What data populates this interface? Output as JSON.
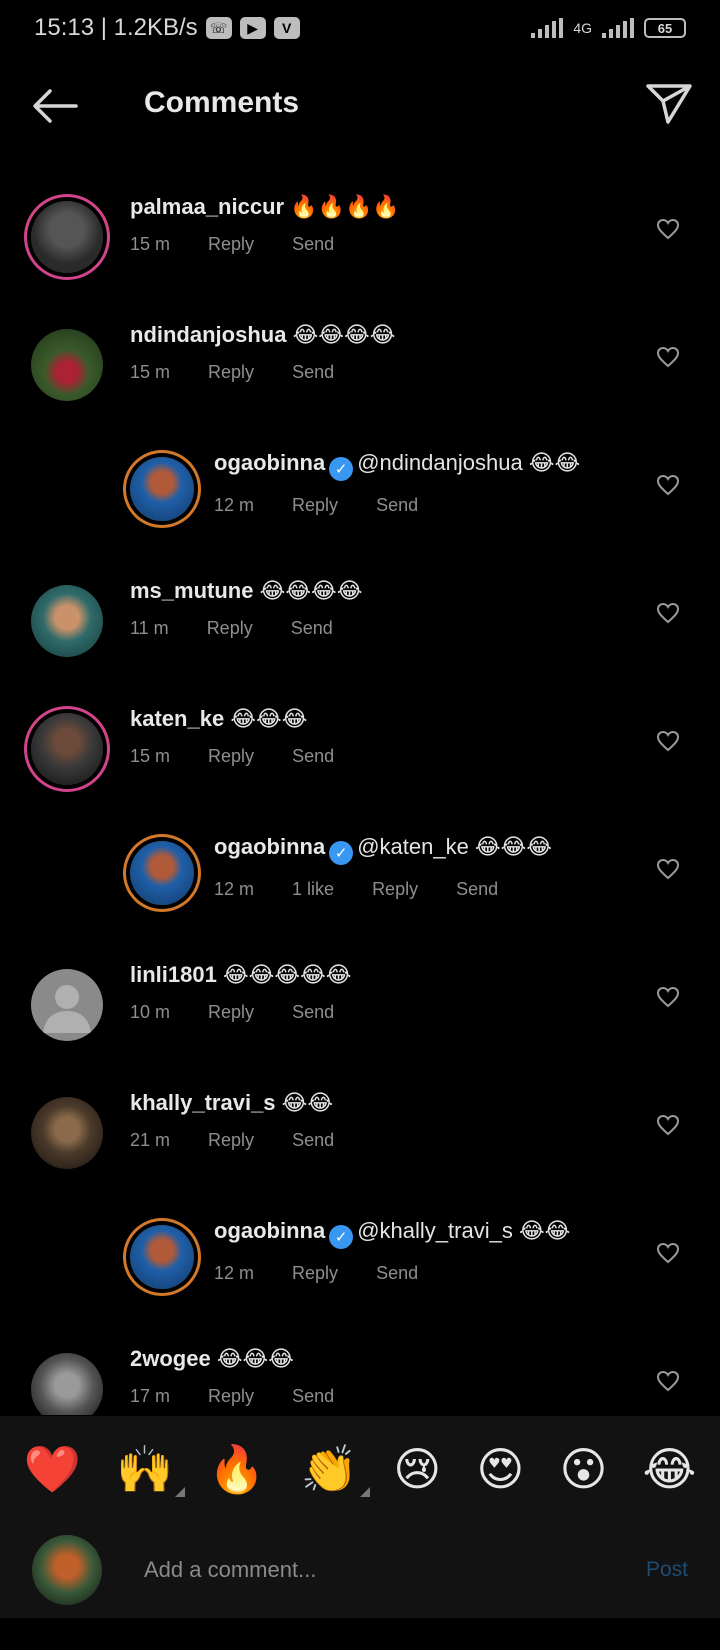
{
  "status_bar": {
    "time_speed": "15:13 | 1.2KB/s",
    "network_label": "4G",
    "battery": "65"
  },
  "header": {
    "title": "Comments"
  },
  "comments": [
    {
      "username": "palmaa_niccur",
      "text": "🔥🔥🔥🔥",
      "time": "15 m",
      "reply": "Reply",
      "send": "Send",
      "likes": ""
    },
    {
      "username": "ndindanjoshua",
      "text": "😂😂😂😂",
      "time": "15 m",
      "reply": "Reply",
      "send": "Send",
      "likes": ""
    },
    {
      "username": "ogaobinna",
      "text": "@ndindanjoshua 😂😂",
      "time": "12 m",
      "reply": "Reply",
      "send": "Send",
      "likes": ""
    },
    {
      "username": "ms_mutune",
      "text": "😂😂😂😂",
      "time": "11 m",
      "reply": "Reply",
      "send": "Send",
      "likes": ""
    },
    {
      "username": "katen_ke",
      "text": "😂😂😂",
      "time": "15 m",
      "reply": "Reply",
      "send": "Send",
      "likes": ""
    },
    {
      "username": "ogaobinna",
      "text": "@katen_ke 😂😂😂",
      "time": "12 m",
      "reply": "Reply",
      "send": "Send",
      "likes": "1 like"
    },
    {
      "username": "linli1801",
      "text": "😂😂😂😂😂",
      "time": "10 m",
      "reply": "Reply",
      "send": "Send",
      "likes": ""
    },
    {
      "username": "khally_travi_s",
      "text": "😂😂",
      "time": "21 m",
      "reply": "Reply",
      "send": "Send",
      "likes": ""
    },
    {
      "username": "ogaobinna",
      "text": "@khally_travi_s 😂😂",
      "time": "12 m",
      "reply": "Reply",
      "send": "Send",
      "likes": ""
    },
    {
      "username": "2wogee",
      "text": "😂😂😂",
      "time": "17 m",
      "reply": "Reply",
      "send": "Send",
      "likes": ""
    }
  ],
  "emoji_bar": [
    "❤️",
    "🙌",
    "🔥",
    "👏",
    "😢",
    "😍",
    "😮",
    "😂"
  ],
  "composer": {
    "placeholder": "Add a comment...",
    "post_label": "Post"
  },
  "colors": {
    "background": "#000000",
    "verified": "#3897f0",
    "post_disabled": "#1e4d73",
    "meta_text": "#8e8e8e"
  }
}
